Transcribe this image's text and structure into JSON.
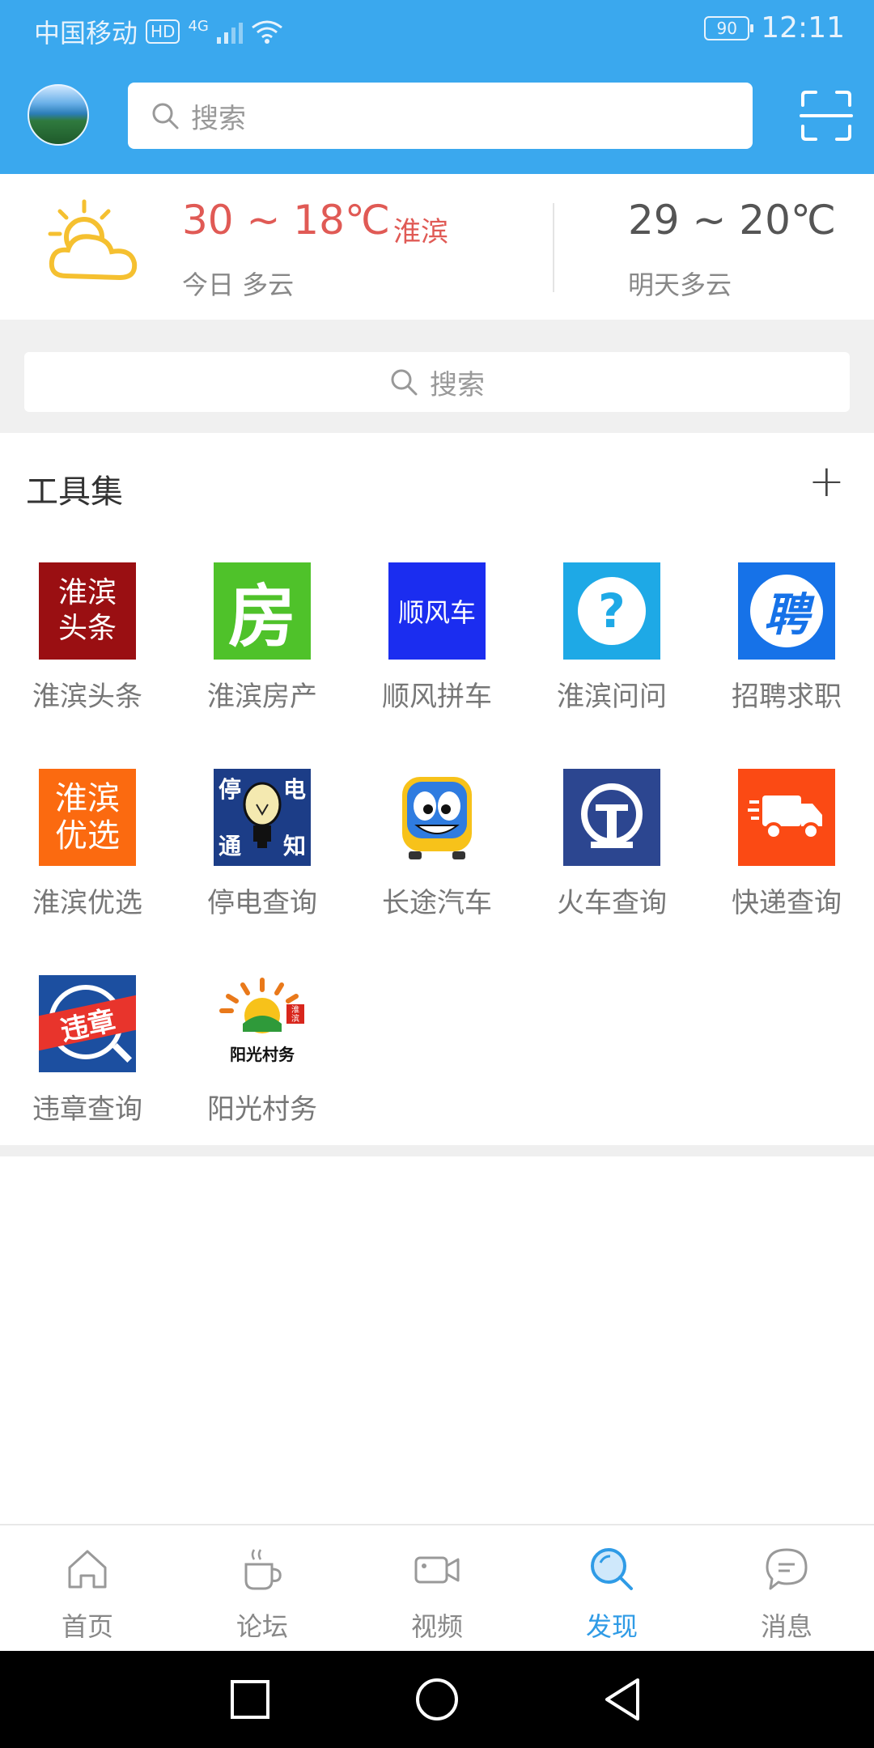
{
  "status_bar": {
    "carrier": "中国移动",
    "hd": "HD",
    "network": "4G",
    "battery": "90",
    "time": "12:11"
  },
  "header": {
    "search_placeholder": "搜索",
    "avatar": "profile-avatar",
    "scan_icon": "scan-icon"
  },
  "weather": {
    "today_temp": "30 ~ 18℃",
    "city": "淮滨",
    "today_condition": "今日 多云",
    "tomorrow_temp": "29 ~ 20℃",
    "tomorrow_condition": "明天多云",
    "icon": "partly-cloudy-icon"
  },
  "secondary_search": {
    "placeholder": "搜索"
  },
  "tools": {
    "title": "工具集",
    "add_label": "+",
    "items": [
      {
        "label": "淮滨头条",
        "icon_text_1": "淮滨",
        "icon_text_2": "头条",
        "color": "#9a0f12"
      },
      {
        "label": "淮滨房产",
        "icon_text": "房",
        "color": "#4fc22a"
      },
      {
        "label": "顺风拼车",
        "icon_text": "顺风车",
        "color": "#1b2df0"
      },
      {
        "label": "淮滨问问",
        "icon_text": "?",
        "color": "#1ea9e6"
      },
      {
        "label": "招聘求职",
        "icon_text": "聘",
        "color": "#1672e8"
      },
      {
        "label": "淮滨优选",
        "icon_text_1": "淮滨",
        "icon_text_2": "优选",
        "color": "#fb6a10"
      },
      {
        "label": "停电查询",
        "icon_text_1": "停",
        "icon_text_2": "电",
        "icon_text_3": "通",
        "icon_text_4": "知",
        "color": "#1c3d87"
      },
      {
        "label": "长途汽车",
        "icon": "bus-icon",
        "color": "#2f7ce0"
      },
      {
        "label": "火车查询",
        "icon": "railway-icon",
        "color": "#2c4690"
      },
      {
        "label": "快递查询",
        "icon": "delivery-truck-icon",
        "color": "#fb4a14"
      },
      {
        "label": "违章查询",
        "icon_text": "违章",
        "color": "#1c4fa0"
      },
      {
        "label": "阳光村务",
        "icon_text_1": "阳光村务",
        "icon_text_2": "淮滨",
        "color": "#e9791a"
      }
    ]
  },
  "bottom_nav": {
    "items": [
      {
        "label": "首页",
        "icon": "home-icon"
      },
      {
        "label": "论坛",
        "icon": "coffee-cup-icon"
      },
      {
        "label": "视频",
        "icon": "video-camera-icon"
      },
      {
        "label": "发现",
        "icon": "discover-search-icon",
        "active": true
      },
      {
        "label": "消息",
        "icon": "chat-bubble-icon"
      }
    ],
    "active_color": "#2f9be6"
  }
}
